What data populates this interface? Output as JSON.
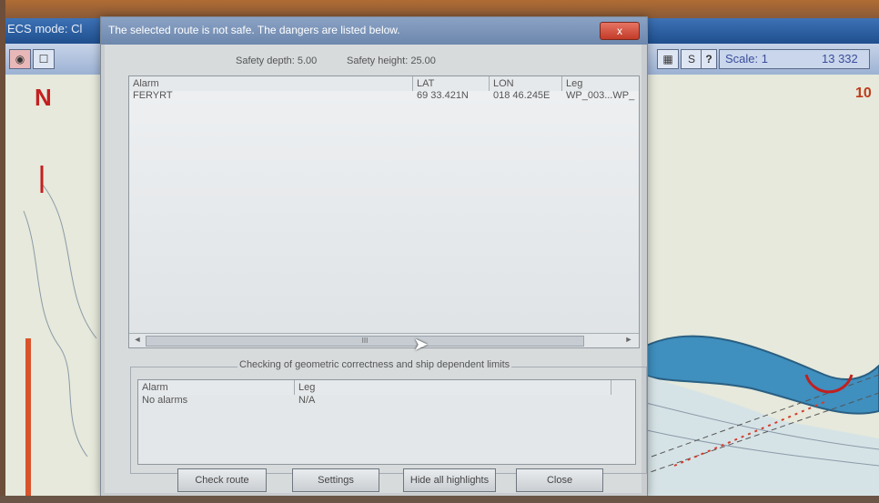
{
  "app": {
    "title": "ECS mode: Cl",
    "scale_label": "Scale: 1",
    "scale_value": "13 332",
    "corner_number": "10",
    "north_symbol": "N",
    "toolbar_s": "S",
    "toolbar_help": "?"
  },
  "dialog": {
    "title": "The selected route is not safe. The dangers are listed below.",
    "close_x": "x",
    "safety_depth": "Safety depth: 5.00",
    "safety_height": "Safety height: 25.00",
    "dangers_table": {
      "headers": [
        "Alarm",
        "LAT",
        "LON",
        "Leg"
      ],
      "rows": [
        [
          "FERYRT",
          "69 33.421N",
          "018 46.245E",
          "WP_003...WP_"
        ]
      ],
      "scroll_thumb": "III"
    },
    "geometric_group_title": "Checking of geometric correctness and ship dependent limits",
    "geometric_table": {
      "headers": [
        "Alarm",
        "Leg"
      ],
      "rows": [
        [
          "No alarms",
          "N/A"
        ]
      ]
    },
    "buttons": {
      "check_route": "Check route",
      "settings": "Settings",
      "hide_highlights": "Hide all highlights",
      "close": "Close"
    }
  }
}
